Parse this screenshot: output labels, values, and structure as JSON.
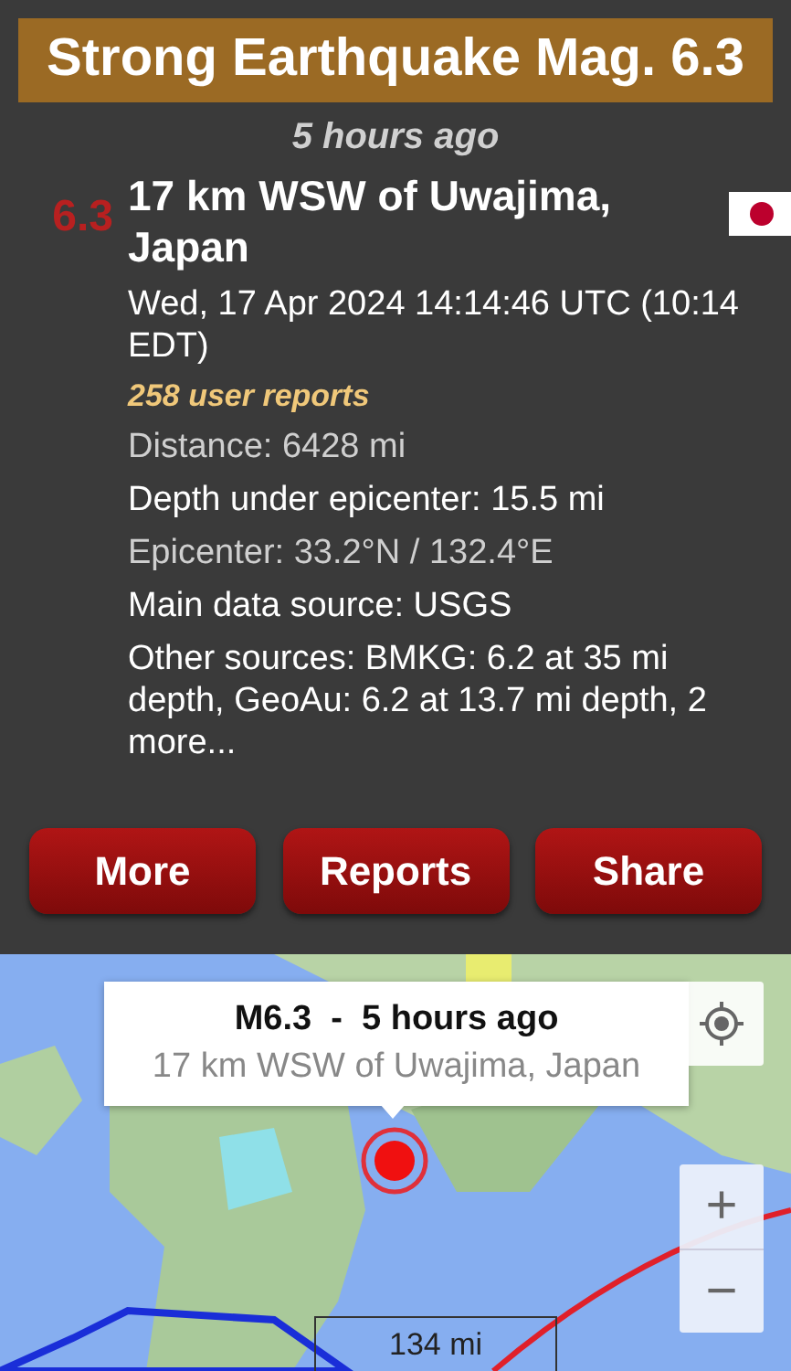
{
  "header": {
    "title": "Strong Earthquake Mag. 6.3",
    "time_ago": "5 hours ago"
  },
  "event": {
    "magnitude": "6.3",
    "location": "17 km WSW of Uwajima, Japan",
    "datetime": "Wed, 17 Apr 2024 14:14:46 UTC (10:14 EDT)",
    "user_reports": "258 user reports",
    "details": [
      {
        "kind": "secondary",
        "text": "Distance: 6428 mi"
      },
      {
        "kind": "primary",
        "text": "Depth under epicenter: 15.5 mi"
      },
      {
        "kind": "secondary",
        "text": "Epicenter: 33.2°N / 132.4°E"
      },
      {
        "kind": "primary",
        "text": "Main data source: USGS"
      },
      {
        "kind": "primary",
        "text": "Other sources: BMKG: 6.2 at 35 mi depth, GeoAu: 6.2 at 13.7 mi depth, 2 more..."
      }
    ]
  },
  "buttons": [
    "More",
    "Reports",
    "Share"
  ],
  "map": {
    "popup": {
      "title": "M6.3  -  5 hours ago",
      "subtitle": "17 km WSW of Uwajima, Japan"
    },
    "scale": "134 mi",
    "zoom_in": "+",
    "zoom_out": "−"
  }
}
